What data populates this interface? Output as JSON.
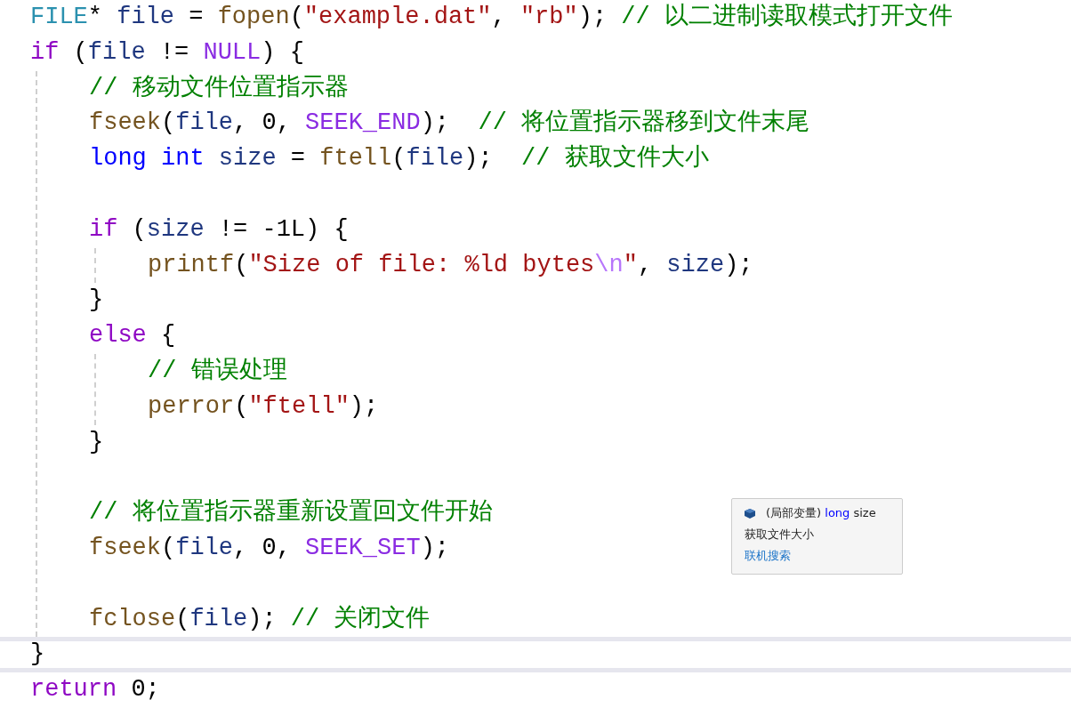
{
  "lines": [
    {
      "kind": "code",
      "current": false,
      "tokens": [
        {
          "text": "FILE",
          "kind": "type"
        },
        {
          "text": "* ",
          "kind": "plain"
        },
        {
          "text": "file",
          "kind": "var"
        },
        {
          "text": " = ",
          "kind": "plain"
        },
        {
          "text": "fopen",
          "kind": "func"
        },
        {
          "text": "(",
          "kind": "plain"
        },
        {
          "text": "\"example.dat\"",
          "kind": "string"
        },
        {
          "text": ", ",
          "kind": "plain"
        },
        {
          "text": "\"rb\"",
          "kind": "string"
        },
        {
          "text": "); ",
          "kind": "plain"
        },
        {
          "text": "// 以二进制读取模式打开文件",
          "kind": "comment"
        }
      ]
    },
    {
      "kind": "code",
      "current": false,
      "tokens": [
        {
          "text": "if",
          "kind": "control"
        },
        {
          "text": " (",
          "kind": "plain"
        },
        {
          "text": "file",
          "kind": "var"
        },
        {
          "text": " != ",
          "kind": "plain"
        },
        {
          "text": "NULL",
          "kind": "macro"
        },
        {
          "text": ") {",
          "kind": "plain"
        }
      ],
      "children": [
        {
          "kind": "code",
          "tokens": [
            {
              "text": "// 移动文件位置指示器",
              "kind": "comment"
            }
          ]
        },
        {
          "kind": "code",
          "tokens": [
            {
              "text": "fseek",
              "kind": "func"
            },
            {
              "text": "(",
              "kind": "plain"
            },
            {
              "text": "file",
              "kind": "var"
            },
            {
              "text": ", 0, ",
              "kind": "plain"
            },
            {
              "text": "SEEK_END",
              "kind": "macro"
            },
            {
              "text": ");  ",
              "kind": "plain"
            },
            {
              "text": "// 将位置指示器移到文件末尾",
              "kind": "comment"
            }
          ]
        },
        {
          "kind": "code",
          "tokens": [
            {
              "text": "long int",
              "kind": "keyword"
            },
            {
              "text": " size",
              "kind": "var"
            },
            {
              "text": " = ",
              "kind": "plain"
            },
            {
              "text": "ftell",
              "kind": "func"
            },
            {
              "text": "(",
              "kind": "plain"
            },
            {
              "text": "file",
              "kind": "var"
            },
            {
              "text": ");  ",
              "kind": "plain"
            },
            {
              "text": "// 获取文件大小",
              "kind": "comment"
            }
          ]
        },
        {
          "kind": "blank"
        },
        {
          "kind": "code",
          "tokens": [
            {
              "text": "if",
              "kind": "control"
            },
            {
              "text": " (",
              "kind": "plain"
            },
            {
              "text": "size",
              "kind": "var"
            },
            {
              "text": " != -1L) {",
              "kind": "plain"
            }
          ],
          "children": [
            {
              "kind": "code",
              "tokens": [
                {
                  "text": "printf",
                  "kind": "func"
                },
                {
                  "text": "(",
                  "kind": "plain"
                },
                {
                  "text": "\"Size of file: %ld bytes",
                  "kind": "string"
                },
                {
                  "text": "\\n",
                  "kind": "escape"
                },
                {
                  "text": "\"",
                  "kind": "string"
                },
                {
                  "text": ", ",
                  "kind": "plain"
                },
                {
                  "text": "size",
                  "kind": "var"
                },
                {
                  "text": ");",
                  "kind": "plain"
                }
              ]
            }
          ]
        },
        {
          "kind": "code",
          "tokens": [
            {
              "text": "}",
              "kind": "plain"
            }
          ]
        },
        {
          "kind": "code",
          "tokens": [
            {
              "text": "else",
              "kind": "control"
            },
            {
              "text": " {",
              "kind": "plain"
            }
          ],
          "children": [
            {
              "kind": "code",
              "tokens": [
                {
                  "text": "// 错误处理",
                  "kind": "comment"
                }
              ]
            },
            {
              "kind": "code",
              "tokens": [
                {
                  "text": "perror",
                  "kind": "func"
                },
                {
                  "text": "(",
                  "kind": "plain"
                },
                {
                  "text": "\"ftell\"",
                  "kind": "string"
                },
                {
                  "text": ");",
                  "kind": "plain"
                }
              ]
            }
          ]
        },
        {
          "kind": "code",
          "tokens": [
            {
              "text": "}",
              "kind": "plain"
            }
          ]
        },
        {
          "kind": "blank"
        },
        {
          "kind": "code",
          "tokens": [
            {
              "text": "// 将位置指示器重新设置回文件开始",
              "kind": "comment"
            }
          ]
        },
        {
          "kind": "code",
          "tokens": [
            {
              "text": "fseek",
              "kind": "func"
            },
            {
              "text": "(",
              "kind": "plain"
            },
            {
              "text": "file",
              "kind": "var"
            },
            {
              "text": ", 0, ",
              "kind": "plain"
            },
            {
              "text": "SEEK_SET",
              "kind": "macro"
            },
            {
              "text": ");",
              "kind": "plain"
            }
          ]
        },
        {
          "kind": "blank"
        },
        {
          "kind": "code",
          "tokens": [
            {
              "text": "fclose",
              "kind": "func"
            },
            {
              "text": "(",
              "kind": "plain"
            },
            {
              "text": "file",
              "kind": "var"
            },
            {
              "text": "); ",
              "kind": "plain"
            },
            {
              "text": "// 关闭文件",
              "kind": "comment"
            }
          ]
        }
      ]
    },
    {
      "kind": "code",
      "current": true,
      "tokens": [
        {
          "text": "}",
          "kind": "plain"
        }
      ]
    },
    {
      "kind": "code",
      "current": false,
      "tokens": [
        {
          "text": "return",
          "kind": "control"
        },
        {
          "text": " 0;",
          "kind": "plain"
        }
      ]
    }
  ],
  "tooltip": {
    "signature": [
      {
        "text": "(局部变量) ",
        "kind": "plain"
      },
      {
        "text": "long",
        "kind": "keyword"
      },
      {
        "text": " size",
        "kind": "plain"
      }
    ],
    "description": "获取文件大小",
    "link": "联机搜索"
  }
}
